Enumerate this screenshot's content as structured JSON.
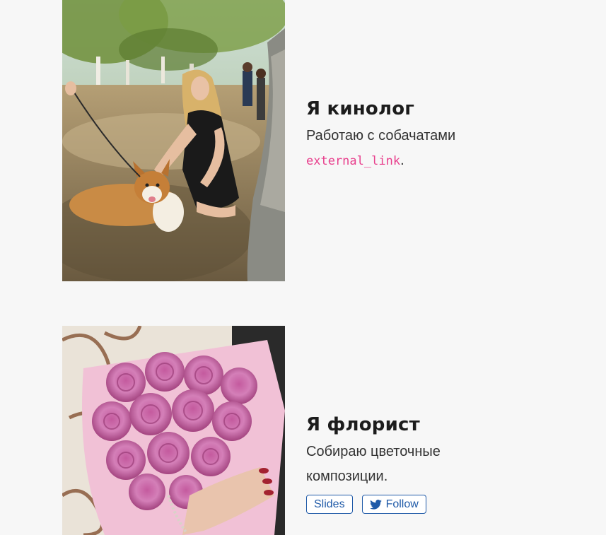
{
  "sections": [
    {
      "title": "Я кинолог",
      "description": "Работаю с собачатами",
      "link_text": "external_link",
      "link_suffix": ".",
      "photo_alt": "Девушка с корги в саду"
    },
    {
      "title": "Я флорист",
      "description": "Собираю цветочные композиции.",
      "photo_alt": "Букет розовых роз",
      "buttons": {
        "slides_label": "Slides",
        "follow_label": "Follow"
      }
    }
  ],
  "icons": {
    "follow_icon": "twitter-icon"
  },
  "colors": {
    "background": "#f7f7f7",
    "link_code": "#e83e8c",
    "button_accent": "#1f5aa8",
    "title": "#1c1c1c"
  }
}
